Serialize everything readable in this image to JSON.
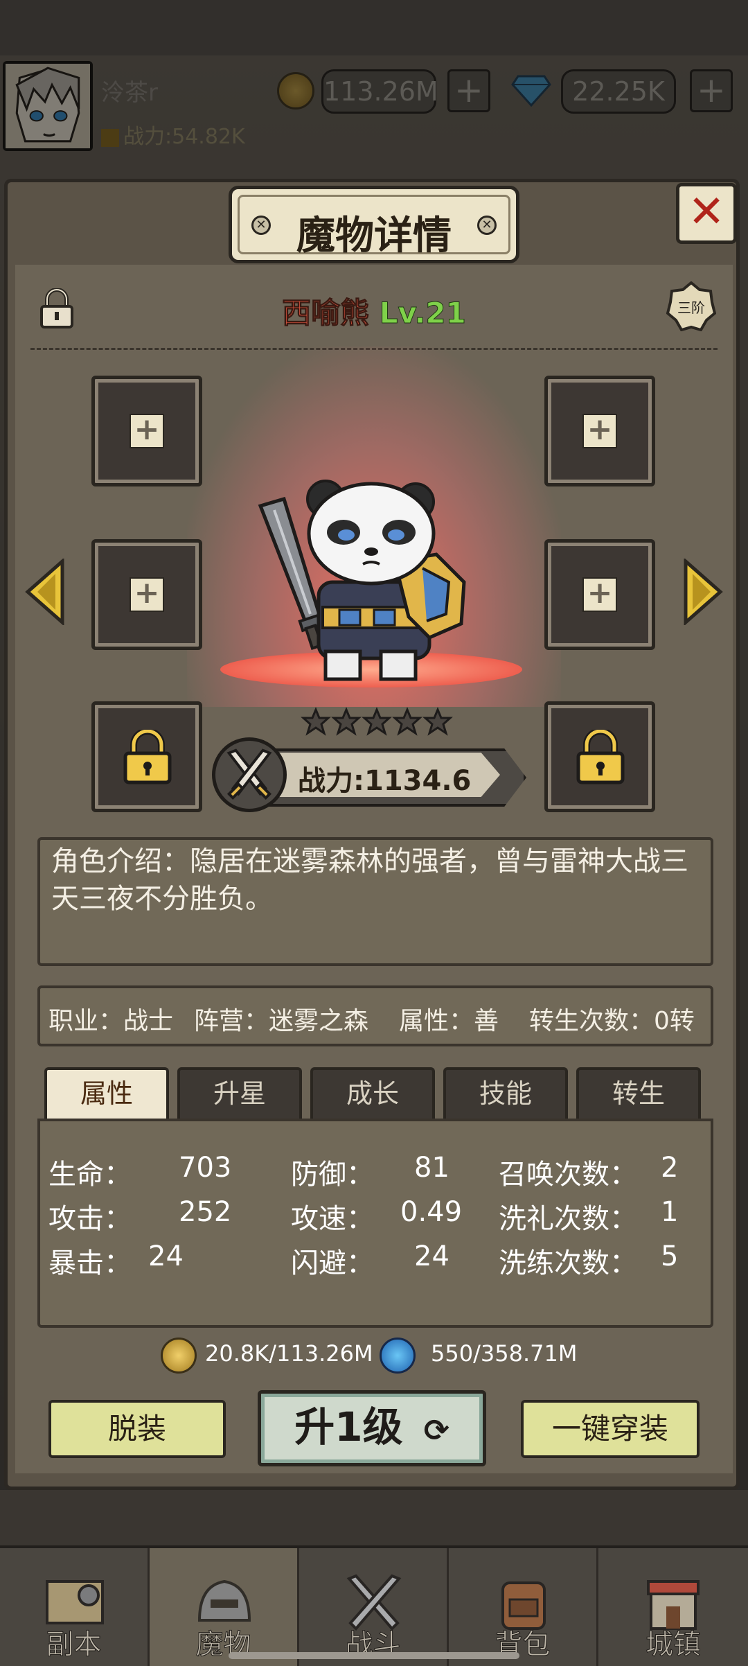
{
  "player": {
    "name": "泠茶r",
    "power": "战力:54.82K",
    "gold": "113.26M",
    "gems": "22.25K"
  },
  "panel": {
    "title": "魔物详情",
    "close": "✕"
  },
  "monster": {
    "name": "西喻熊",
    "level": "Lv.21",
    "tier": "三阶",
    "stars": 5,
    "power": "战力:1134.6",
    "description": "角色介绍：隐居在迷雾森林的强者，曾与雷神大战三天三夜不分胜负。"
  },
  "info": {
    "job": "职业：战士",
    "camp": "阵营：迷雾之森",
    "alignment": "属性：善",
    "rebirth": "转生次数：0转"
  },
  "tabs": [
    "属性",
    "升星",
    "成长",
    "技能",
    "转生"
  ],
  "stats": {
    "hp_label": "生命：",
    "hp": "703",
    "atk_label": "攻击：",
    "atk": "252",
    "crit_label": "暴击：",
    "crit": "24",
    "def_label": "防御：",
    "def": "81",
    "spd_label": "攻速：",
    "spd": "0.49",
    "eva_label": "闪避：",
    "eva": "24",
    "summon_label": "召唤次数：",
    "summon": "2",
    "baptize_label": "洗礼次数：",
    "baptize": "1",
    "refine_label": "洗练次数：",
    "refine": "5"
  },
  "cost": {
    "gold": "20.8K/113.26M",
    "essence": "550/358.71M"
  },
  "buttons": {
    "unequip": "脱装",
    "levelup": "升1级",
    "equip_all": "一键穿装"
  },
  "nav": [
    "副本",
    "魔物",
    "战斗",
    "背包",
    "城镇"
  ],
  "colors": {
    "name": "#e05640",
    "level": "#7fd14a",
    "button": "#dfe19a",
    "panel": "#6c6456"
  }
}
